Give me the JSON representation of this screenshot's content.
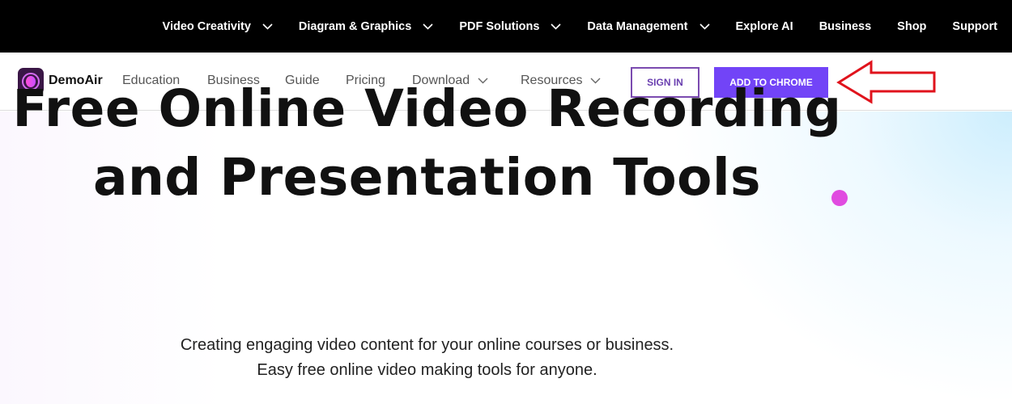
{
  "topbar": {
    "items": [
      {
        "label": "Video Creativity",
        "has_dropdown": true
      },
      {
        "label": "Diagram & Graphics",
        "has_dropdown": true
      },
      {
        "label": "PDF Solutions",
        "has_dropdown": true
      },
      {
        "label": "Data Management",
        "has_dropdown": true
      },
      {
        "label": "Explore AI",
        "has_dropdown": false
      },
      {
        "label": "Business",
        "has_dropdown": false
      },
      {
        "label": "Shop",
        "has_dropdown": false
      },
      {
        "label": "Support",
        "has_dropdown": false
      }
    ]
  },
  "navbar": {
    "brand": "DemoAir",
    "items": [
      {
        "label": "Education",
        "has_dropdown": false
      },
      {
        "label": "Business",
        "has_dropdown": false
      },
      {
        "label": "Guide",
        "has_dropdown": false
      },
      {
        "label": "Pricing",
        "has_dropdown": false
      },
      {
        "label": "Download",
        "has_dropdown": true
      },
      {
        "label": "Resources",
        "has_dropdown": true
      }
    ],
    "sign_in_label": "SIGN IN",
    "add_to_chrome_label": "ADD TO CHROME"
  },
  "annotation": {
    "type": "arrow",
    "color": "#e0131c",
    "points_to": "add-to-chrome-button"
  },
  "hero": {
    "title_line1": "Free Online Video Recording",
    "title_line2": "and Presentation Tools",
    "subtitle_line1": "Creating engaging video content for your online courses or business.",
    "subtitle_line2": "Easy free online video making tools for anyone."
  },
  "colors": {
    "accent": "#7244f7",
    "sign_in_border": "#7b4bb0",
    "dot": "#e04be0",
    "topbar_bg": "#000000"
  }
}
